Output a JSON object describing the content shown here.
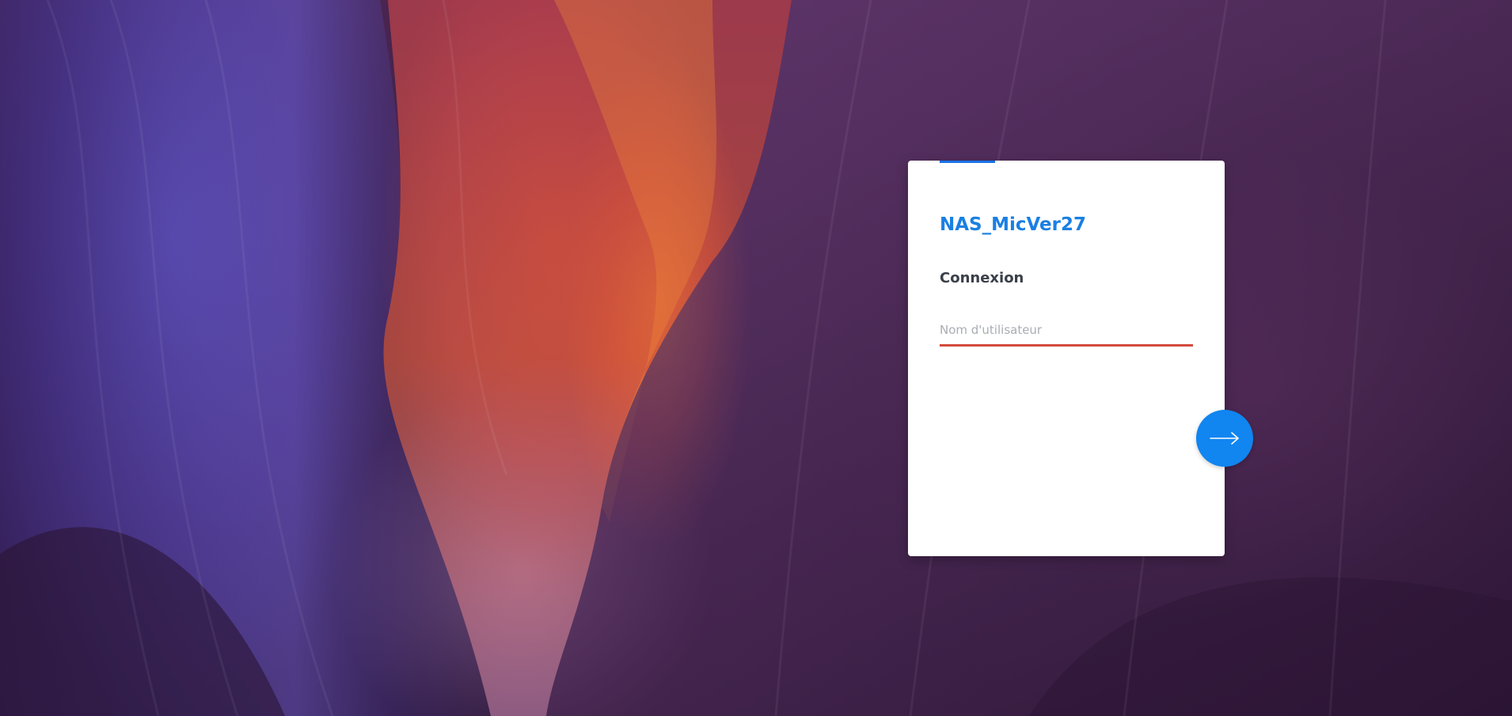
{
  "app": {
    "host_name": "NAS_MicVer27"
  },
  "login": {
    "heading": "Connexion",
    "username_placeholder": "Nom d'utilisateur",
    "username_value": ""
  },
  "icons": {
    "submit": "arrow-right-icon"
  },
  "colors": {
    "accent": "#1a7fe3",
    "button": "#1185f0",
    "input_underline": "#d44a3c",
    "heading_text": "#3a4049"
  }
}
